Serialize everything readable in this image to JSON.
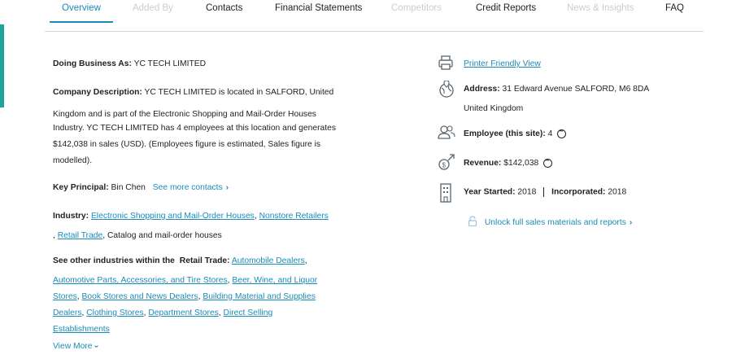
{
  "tabs": [
    {
      "label": "Overview",
      "state": "active"
    },
    {
      "label": "Added By",
      "state": "disabled"
    },
    {
      "label": "Contacts",
      "state": "normal"
    },
    {
      "label": "Financial Statements",
      "state": "normal"
    },
    {
      "label": "Competitors",
      "state": "disabled"
    },
    {
      "label": "Credit Reports",
      "state": "normal"
    },
    {
      "label": "News & Insights",
      "state": "disabled"
    },
    {
      "label": "FAQ",
      "state": "normal"
    }
  ],
  "overview": {
    "dba_label": "Doing Business As:",
    "dba_value": "YC TECH LIMITED",
    "desc_label": "Company Description:",
    "desc_lines": [
      "YC TECH LIMITED is located in SALFORD, United",
      "Kingdom and is part of the Electronic Shopping and Mail-Order Houses",
      "Industry. YC TECH LIMITED has 4 employees at this location and generates",
      "$142,038 in sales (USD). (Employees figure is estimated, Sales figure is",
      "modelled)."
    ],
    "principal_label": "Key Principal:",
    "principal_value": "Bin Chen",
    "see_more_contacts": "See more contacts",
    "industry_label": "Industry:",
    "industry_links": [
      "Electronic Shopping and Mail-Order Houses",
      "Nonstore Retailers",
      "Retail Trade"
    ],
    "industry_extra": "Catalog and mail-order houses",
    "other_label": "See other industries within the",
    "other_sector": "Retail Trade:",
    "other_links": [
      "Automobile Dealers",
      "Automotive Parts, Accessories, and Tire Stores",
      "Beer, Wine, and Liquor",
      "Stores",
      "Book Stores and News Dealers",
      "Building Material and Supplies",
      "Dealers",
      "Clothing Stores",
      "Department Stores",
      "Direct Selling",
      "Establishments"
    ],
    "view_more": "View More"
  },
  "sidebar": {
    "printer_link": "Printer Friendly View",
    "address_label": "Address:",
    "address_line1": "31 Edward Avenue SALFORD, M6 8DA",
    "address_line2": "United Kingdom",
    "employee_label": "Employee (this site):",
    "employee_value": "4",
    "revenue_label": "Revenue:",
    "revenue_value": "$142,038",
    "year_label": "Year Started:",
    "year_value": "2018",
    "incorporated_label": "Incorporated:",
    "incorporated_value": "2018",
    "unlock_link": "Unlock full sales materials and reports"
  },
  "colors": {
    "accent": "#1a8bb8",
    "teal_bar": "#20a39a",
    "disabled": "#c9cdd2"
  }
}
